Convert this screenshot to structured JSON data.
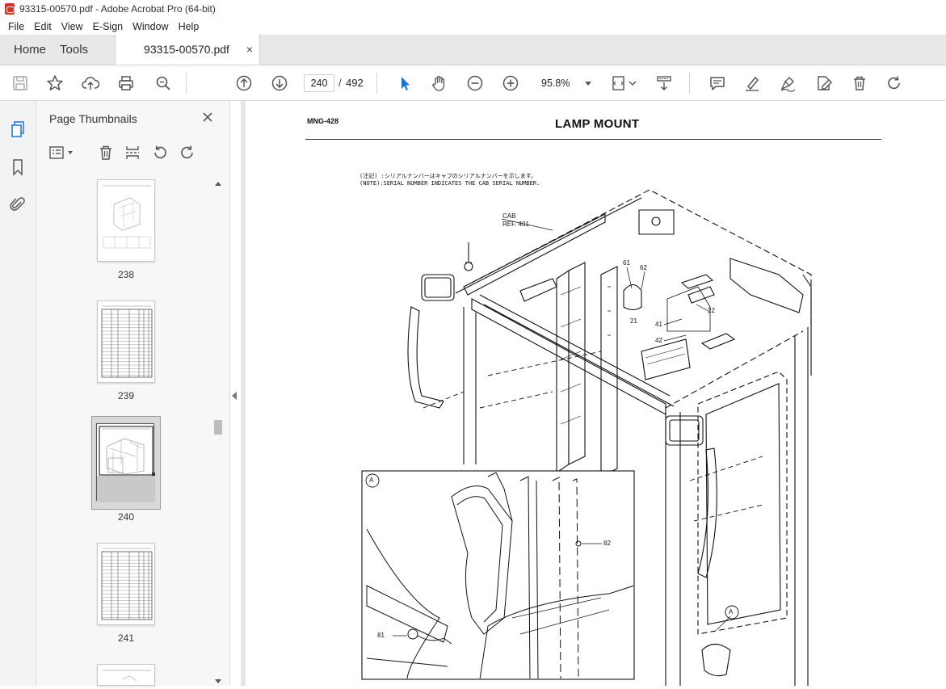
{
  "window": {
    "title": "93315-00570.pdf - Adobe Acrobat Pro (64-bit)"
  },
  "menu": [
    "File",
    "Edit",
    "View",
    "E-Sign",
    "Window",
    "Help"
  ],
  "tabs": {
    "home": "Home",
    "tools": "Tools",
    "document": "93315-00570.pdf",
    "close_glyph": "×"
  },
  "toolbar": {
    "current_page": "240",
    "page_separator": "/",
    "total_pages": "492",
    "zoom": "95.8%"
  },
  "thumbnails": {
    "title": "Page Thumbnails",
    "close_glyph": "✕",
    "pages": [
      {
        "label": "238",
        "selected": false
      },
      {
        "label": "239",
        "selected": false
      },
      {
        "label": "240",
        "selected": true
      },
      {
        "label": "241",
        "selected": false
      }
    ]
  },
  "document": {
    "code": "MNG-428",
    "heading": "LAMP MOUNT",
    "note_jp": "(注記) :シリアルナンバーはキャブのシリアルナンバーを示します。",
    "note_en": "(NOTE):SERIAL NUMBER INDICATES THE CAB SERIAL NUMBER.",
    "callouts": {
      "cab": "CAB",
      "ref": "REF. 401",
      "p61": "61",
      "p62": "62",
      "p21": "21",
      "p22": "22",
      "p41": "41",
      "p42": "42",
      "detail_a": "A",
      "detail_a2": "A",
      "p82": "82",
      "p81": "81"
    }
  },
  "colors": {
    "accent": "#1473e6",
    "tab_bg": "#e8e8e8",
    "panel_bg": "#f7f7f7"
  }
}
